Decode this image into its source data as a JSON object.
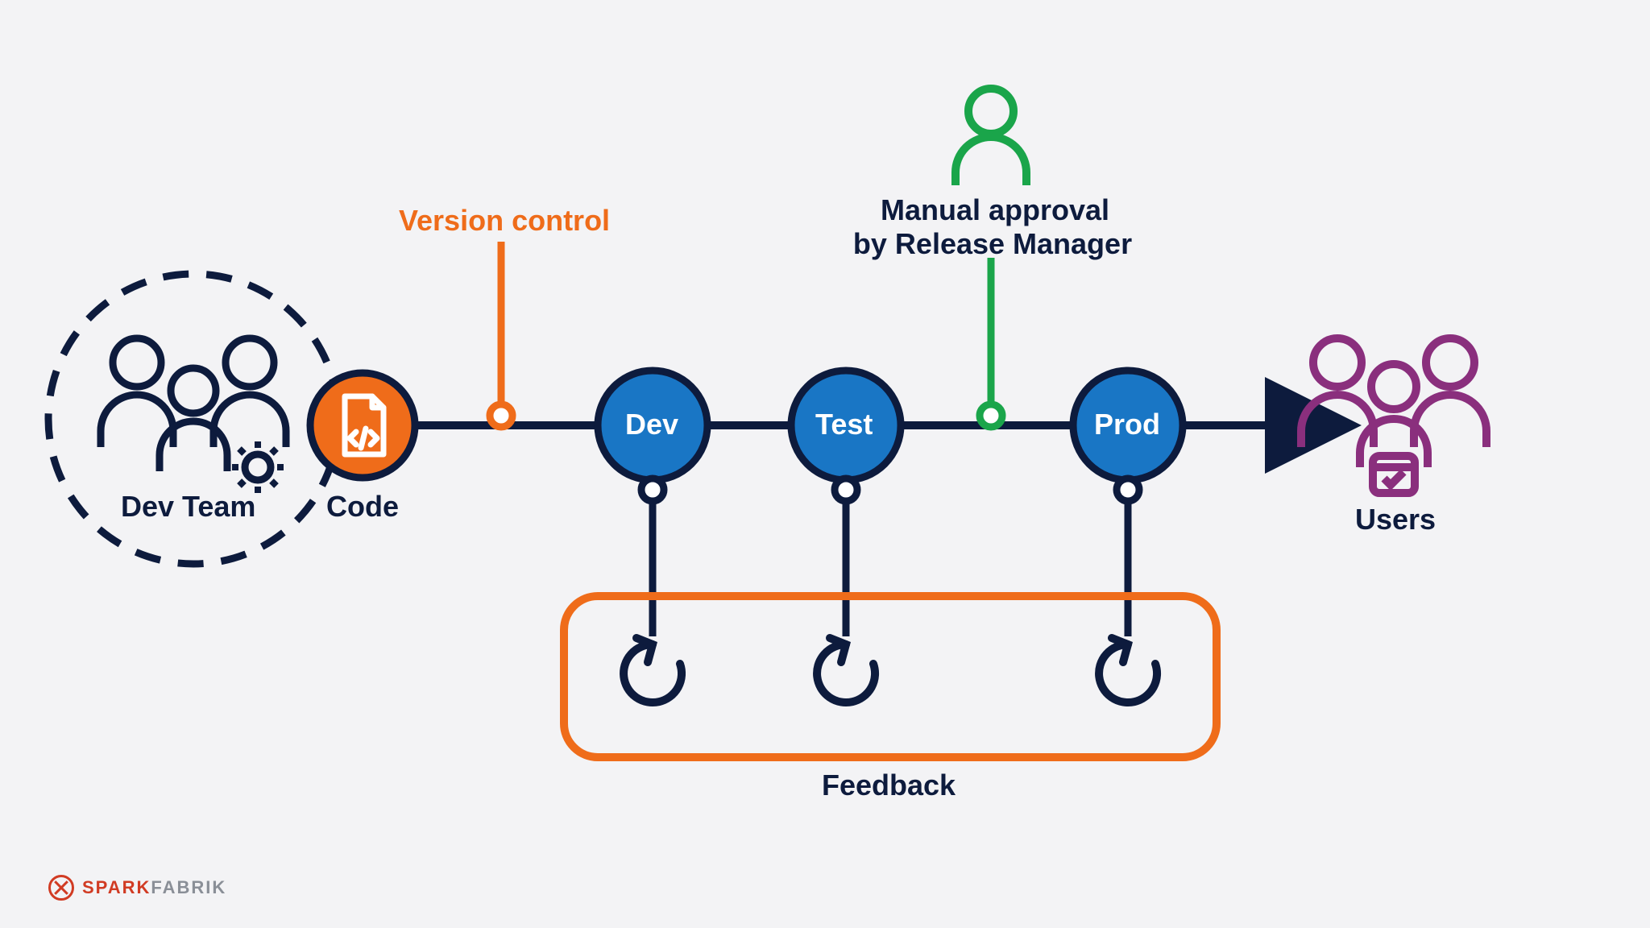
{
  "colors": {
    "navy": "#0d1b3d",
    "orange": "#ef6c1a",
    "blue": "#1976c5",
    "green": "#1aa54a",
    "purple": "#8a2f7d"
  },
  "labels": {
    "dev_team": "Dev Team",
    "code": "Code",
    "version_control": "Version control",
    "stage_dev": "Dev",
    "stage_test": "Test",
    "stage_prod": "Prod",
    "manual_approval_l1": "Manual approval",
    "manual_approval_l2": "by Release Manager",
    "feedback": "Feedback",
    "users": "Users"
  },
  "brand": {
    "part1": "SPARK",
    "part2": "FABRIK"
  }
}
